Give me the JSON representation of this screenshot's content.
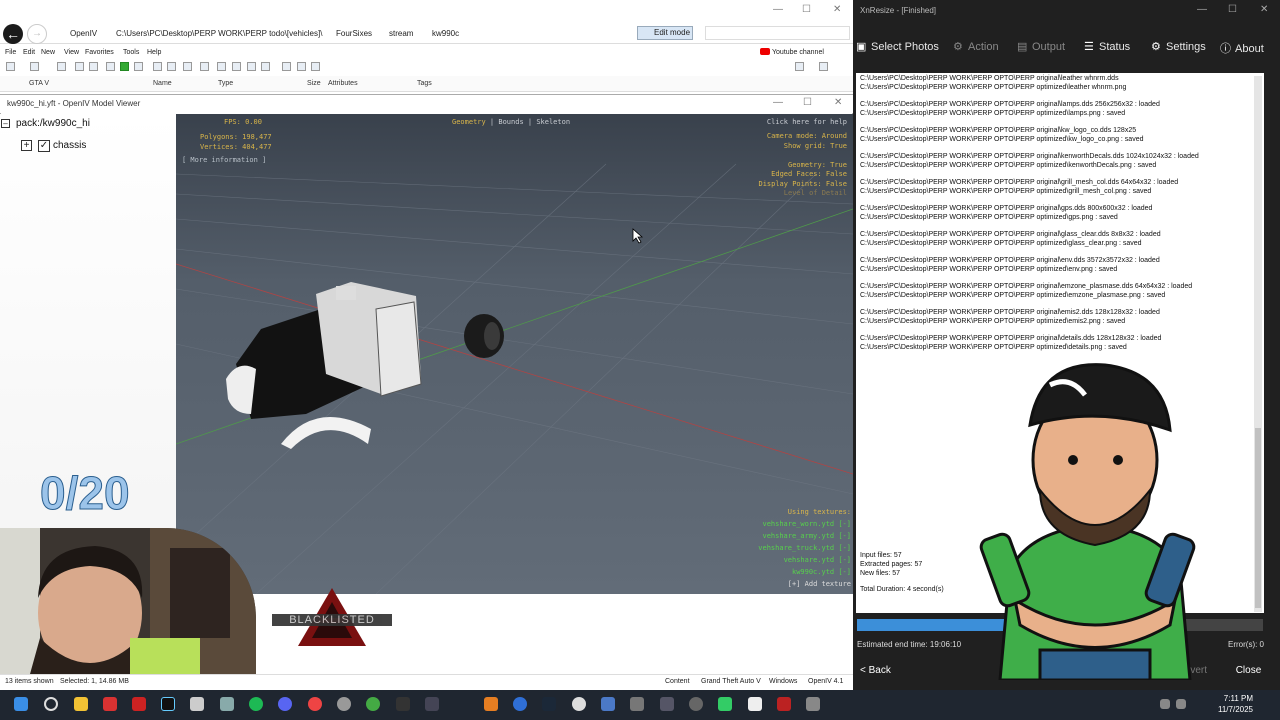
{
  "openiv": {
    "crumbs": [
      "OpenIV",
      "C:\\Users\\PC\\Desktop\\PERP WORK\\PERP todo\\[vehicles]\\",
      "FourSixes",
      "stream",
      "kw990c"
    ],
    "edit_mode": "Edit mode",
    "menu": [
      "File",
      "Edit",
      "New",
      "View",
      "Favorites",
      "Tools",
      "Help"
    ],
    "youtube": "Youtube channel",
    "tree_root": "GTA V",
    "columns": [
      "Name",
      "Type",
      "Size",
      "Attributes",
      "Tags"
    ],
    "status": {
      "items_shown": "13 items shown",
      "selected": "Selected: 1, 14.86 MB",
      "content": "Content",
      "game": "Grand Theft Auto V",
      "os": "Windows",
      "version": "OpenIV 4.1"
    }
  },
  "viewer": {
    "title": "kw990c_hi.yft - OpenIV Model Viewer",
    "tree_pack": "pack:/kw990c_hi",
    "tree_chassis": "chassis",
    "fps": "FPS: 0.00",
    "polygons": "Polygons: 198,477",
    "vertices": "Vertices: 404,477",
    "more_info": "[ More information ]",
    "tabs": [
      "Geometry",
      "Bounds",
      "Skeleton"
    ],
    "help": "Click here for help",
    "cam_stats": [
      "Camera mode: Around",
      "Show grid: True",
      "",
      "Geometry: True",
      "Edged Faces: False",
      "Display Points: False",
      "Level of Detail"
    ],
    "textures_header": "Using textures:",
    "textures": [
      "vehshare_worn.ytd [-]",
      "vehshare_army.ytd [-]",
      "vehshare_truck.ytd [-]",
      "vehshare.ytd [-]",
      "kw990c.ytd [-]"
    ],
    "add_texture": "[+] Add texture"
  },
  "overlay": {
    "counter": "0/20",
    "logo": "BLACKLISTED"
  },
  "xnresize": {
    "title": "XnResize - [Finished]",
    "tabs": [
      "Select Photos",
      "Action",
      "Output",
      "Status",
      "Settings",
      "About"
    ],
    "log": [
      "C:\\Users\\PC\\Desktop\\PERP WORK\\PERP OPTO\\PERP original\\leather whnrm.dds",
      "C:\\Users\\PC\\Desktop\\PERP WORK\\PERP OPTO\\PERP optimized\\leather whnrm.png",
      "C:\\Users\\PC\\Desktop\\PERP WORK\\PERP OPTO\\PERP original\\lamps.dds 256x256x32 : loaded",
      "C:\\Users\\PC\\Desktop\\PERP WORK\\PERP OPTO\\PERP optimized\\lamps.png : saved",
      "C:\\Users\\PC\\Desktop\\PERP WORK\\PERP OPTO\\PERP original\\kw_logo_co.dds 128x25",
      "C:\\Users\\PC\\Desktop\\PERP WORK\\PERP OPTO\\PERP optimized\\kw_logo_co.png : saved",
      "C:\\Users\\PC\\Desktop\\PERP WORK\\PERP OPTO\\PERP original\\kenworthDecals.dds 1024x1024x32 : loaded",
      "C:\\Users\\PC\\Desktop\\PERP WORK\\PERP OPTO\\PERP optimized\\kenworthDecals.png : saved",
      "C:\\Users\\PC\\Desktop\\PERP WORK\\PERP OPTO\\PERP original\\grill_mesh_col.dds 64x64x32 : loaded",
      "C:\\Users\\PC\\Desktop\\PERP WORK\\PERP OPTO\\PERP optimized\\grill_mesh_col.png : saved",
      "C:\\Users\\PC\\Desktop\\PERP WORK\\PERP OPTO\\PERP original\\gps.dds 800x600x32 : loaded",
      "C:\\Users\\PC\\Desktop\\PERP WORK\\PERP OPTO\\PERP optimized\\gps.png : saved",
      "C:\\Users\\PC\\Desktop\\PERP WORK\\PERP OPTO\\PERP original\\glass_clear.dds 8x8x32 : loaded",
      "C:\\Users\\PC\\Desktop\\PERP WORK\\PERP OPTO\\PERP optimized\\glass_clear.png : saved",
      "C:\\Users\\PC\\Desktop\\PERP WORK\\PERP OPTO\\PERP original\\env.dds 3572x3572x32 : loaded",
      "C:\\Users\\PC\\Desktop\\PERP WORK\\PERP OPTO\\PERP optimized\\env.png : saved",
      "C:\\Users\\PC\\Desktop\\PERP WORK\\PERP OPTO\\PERP original\\emzone_plasmase.dds 64x64x32 : loaded",
      "C:\\Users\\PC\\Desktop\\PERP WORK\\PERP OPTO\\PERP optimized\\emzone_plasmase.png : saved",
      "C:\\Users\\PC\\Desktop\\PERP WORK\\PERP OPTO\\PERP original\\emis2.dds 128x128x32 : loaded",
      "C:\\Users\\PC\\Desktop\\PERP WORK\\PERP OPTO\\PERP optimized\\emis2.png : saved",
      "C:\\Users\\PC\\Desktop\\PERP WORK\\PERP OPTO\\PERP original\\details.dds 128x128x32 : loaded",
      "C:\\Users\\PC\\Desktop\\PERP WORK\\PERP OPTO\\PERP optimized\\details.png : saved"
    ],
    "summary": [
      "Input files: 57",
      "Extracted pages: 57",
      "New files: 57",
      "Total Duration: 4 second(s)"
    ],
    "progress": 0.6,
    "end_time": "Estimated end time: 19:06:10",
    "errors": "Error(s): 0",
    "back": "< Back",
    "convert": "Convert",
    "close": "Close"
  },
  "taskbar": {
    "time": "7:11 PM",
    "date": "11/7/2025"
  },
  "colors": {
    "accent": "#3c8fd9",
    "hud_yellow": "#d9b54a",
    "hud_green": "#57d04c"
  }
}
